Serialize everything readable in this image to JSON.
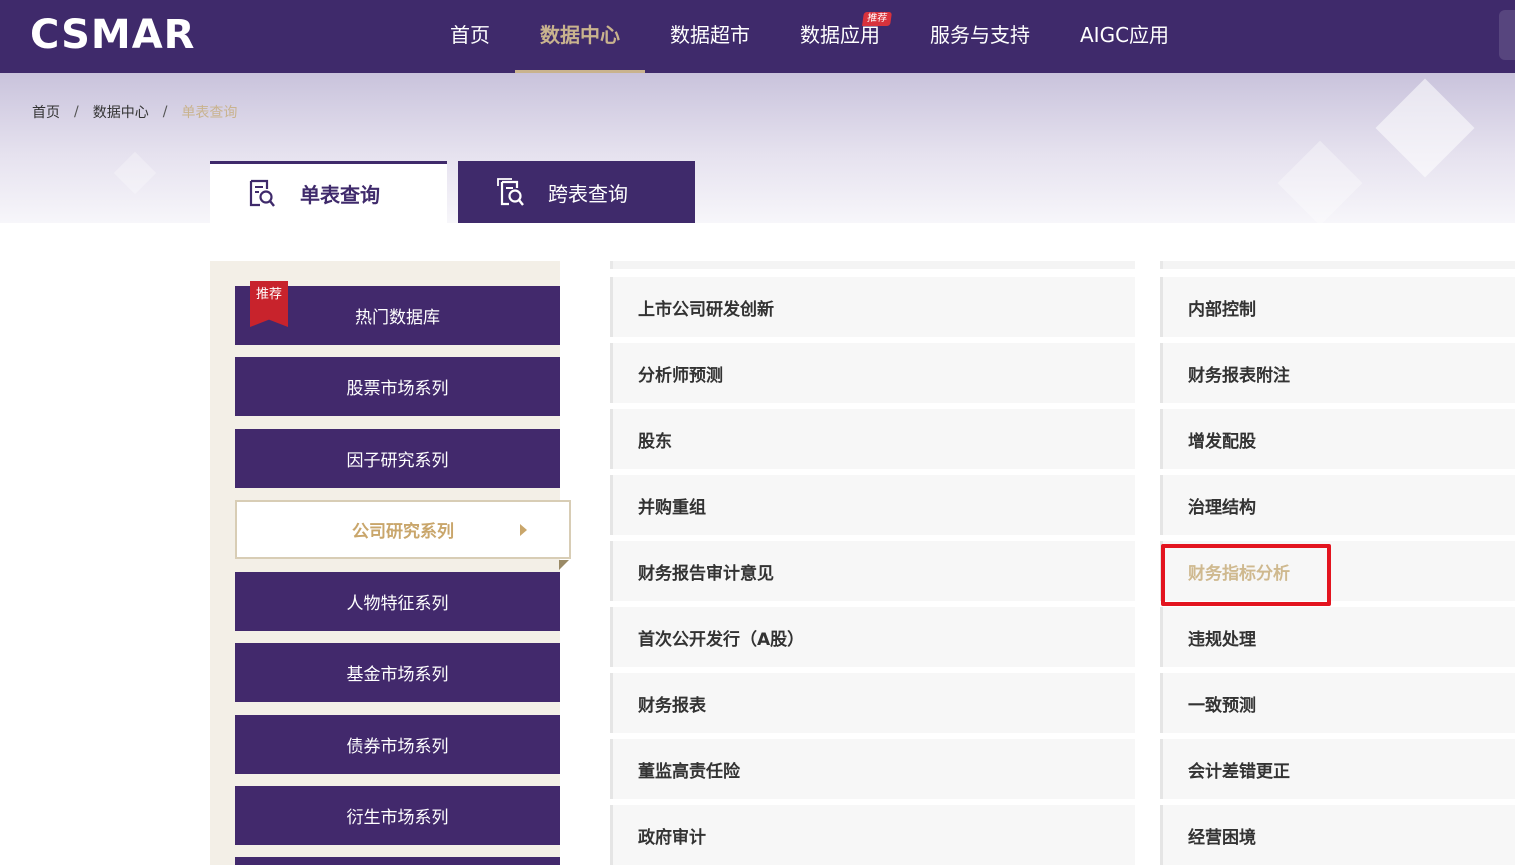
{
  "header": {
    "logo": "CSMAR",
    "nav": [
      {
        "label": "首页"
      },
      {
        "label": "数据中心"
      },
      {
        "label": "数据超市"
      },
      {
        "label": "数据应用",
        "badge": "推荐"
      },
      {
        "label": "服务与支持"
      },
      {
        "label": "AIGC应用"
      }
    ],
    "active_nav": "数据中心"
  },
  "breadcrumb": {
    "items": [
      "首页",
      "数据中心",
      "单表查询"
    ],
    "separator": "/"
  },
  "tabs": {
    "single": "单表查询",
    "cross": "跨表查询"
  },
  "sidebar": {
    "ribbon": "推荐",
    "items": [
      {
        "label": "热门数据库"
      },
      {
        "label": "股票市场系列"
      },
      {
        "label": "因子研究系列"
      },
      {
        "label": "公司研究系列"
      },
      {
        "label": "人物特征系列"
      },
      {
        "label": "基金市场系列"
      },
      {
        "label": "债券市场系列"
      },
      {
        "label": "衍生市场系列"
      }
    ],
    "active": "公司研究系列"
  },
  "databases": {
    "col_a": [
      "上市公司研发创新",
      "分析师预测",
      "股东",
      "并购重组",
      "财务报告审计意见",
      "首次公开发行（A股）",
      "财务报表",
      "董监高责任险",
      "政府审计"
    ],
    "col_b": [
      "内部控制",
      "财务报表附注",
      "增发配股",
      "治理结构",
      "财务指标分析",
      "违规处理",
      "一致预测",
      "会计差错更正",
      "经营困境"
    ],
    "highlighted": "财务指标分析"
  },
  "colors": {
    "primary": "#3f2a6b",
    "accent": "#c9b38e",
    "highlight_box": "#e3141f",
    "ribbon": "#c8232c"
  }
}
